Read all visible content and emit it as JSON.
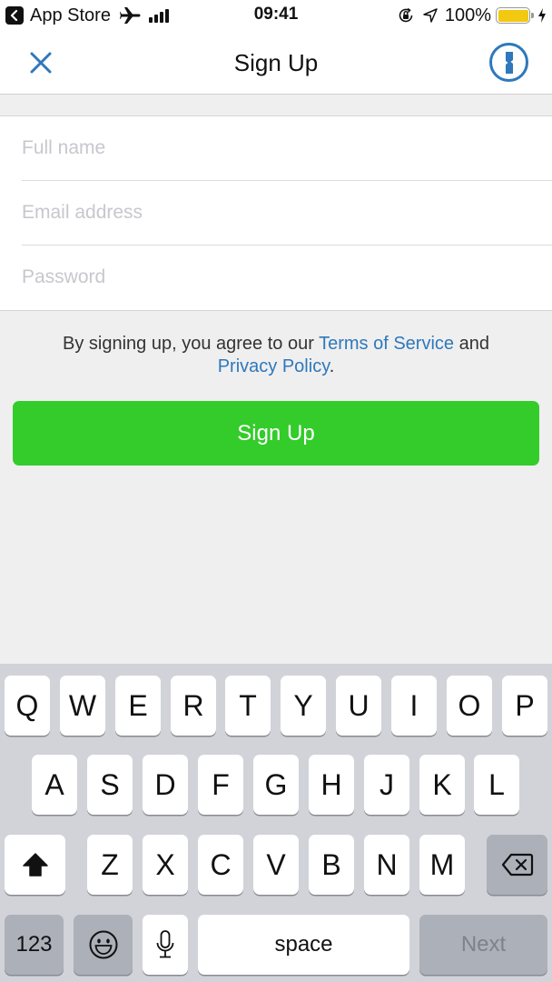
{
  "status_bar": {
    "back_app": "App Store",
    "time": "09:41",
    "battery_percent": "100%",
    "battery_level": 1.0,
    "battery_color": "#f2c811",
    "icons": [
      "back-chevron-icon",
      "airplane-icon",
      "signal-icon",
      "orientation-lock-icon",
      "location-icon",
      "battery-icon",
      "charging-bolt-icon"
    ]
  },
  "nav": {
    "title": "Sign Up",
    "close_icon": "close-icon",
    "right_icon": "1password-icon",
    "accent_color": "#2e78bb"
  },
  "form": {
    "fields": [
      {
        "name": "full-name",
        "placeholder": "Full name",
        "value": ""
      },
      {
        "name": "email",
        "placeholder": "Email address",
        "value": ""
      },
      {
        "name": "password",
        "placeholder": "Password",
        "value": ""
      }
    ]
  },
  "terms": {
    "prefix": "By signing up, you agree to our ",
    "terms_link": "Terms of Service",
    "middle": " and",
    "privacy_link": "Privacy Policy",
    "suffix": "."
  },
  "signup_button": {
    "label": "Sign Up",
    "color": "#33cc2b"
  },
  "keyboard": {
    "row1": [
      "Q",
      "W",
      "E",
      "R",
      "T",
      "Y",
      "U",
      "I",
      "O",
      "P"
    ],
    "row2": [
      "A",
      "S",
      "D",
      "F",
      "G",
      "H",
      "J",
      "K",
      "L"
    ],
    "row3": [
      "Z",
      "X",
      "C",
      "V",
      "B",
      "N",
      "M"
    ],
    "numbers_label": "123",
    "space_label": "space",
    "return_label": "Next",
    "icons": [
      "shift-icon",
      "delete-icon",
      "emoji-icon",
      "microphone-icon"
    ]
  }
}
